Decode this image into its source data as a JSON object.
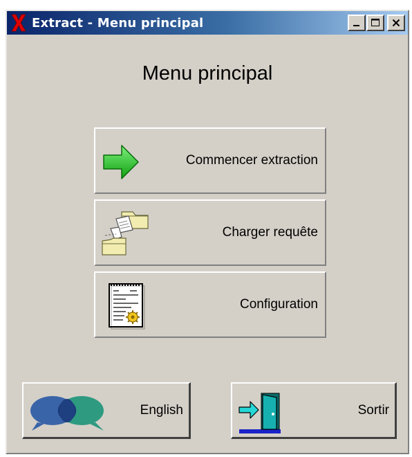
{
  "window": {
    "title": "Extract - Menu principal",
    "controls": {
      "minimize_icon": "minimize-icon",
      "maximize_icon": "maximize-icon",
      "close_icon": "close-icon"
    }
  },
  "main": {
    "heading": "Menu principal",
    "buttons": [
      {
        "label": "Commencer extraction",
        "icon": "green-arrow-icon"
      },
      {
        "label": "Charger requête",
        "icon": "load-folder-icon"
      },
      {
        "label": "Configuration",
        "icon": "settings-document-icon"
      }
    ]
  },
  "footer": {
    "english_label": "English",
    "exit_label": "Sortir"
  },
  "colors": {
    "titlebar_start": "#0a246a",
    "titlebar_end": "#a6caf0",
    "window_bg": "#d4d0c8",
    "accent_red": "#e00000",
    "arrow_green": "#22c422"
  }
}
